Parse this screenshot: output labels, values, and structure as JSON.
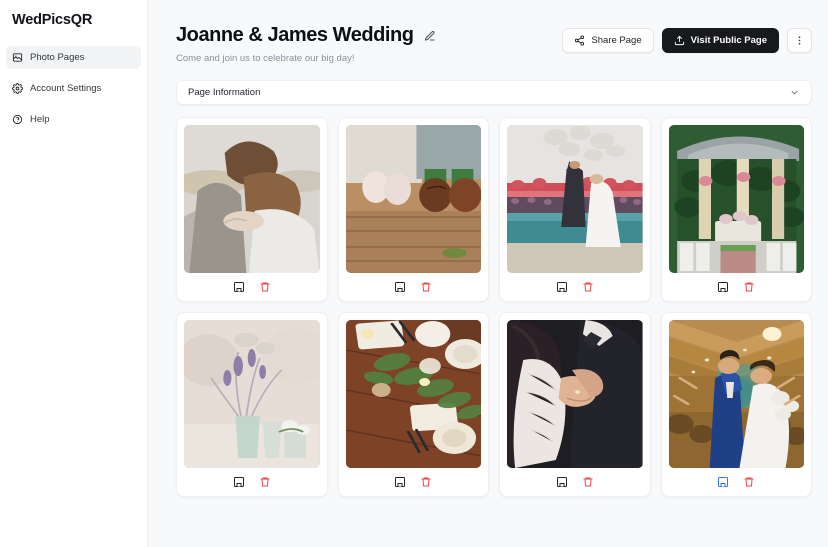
{
  "brand": "WedPicsQR",
  "sidebar": {
    "items": [
      {
        "label": "Photo Pages",
        "icon": "image-icon",
        "active": true
      },
      {
        "label": "Account Settings",
        "icon": "gear-icon",
        "active": false
      },
      {
        "label": "Help",
        "icon": "help-circle-icon",
        "active": false
      }
    ]
  },
  "header": {
    "title": "Joanne & James Wedding",
    "subtitle": "Come and join us to celebrate our big day!",
    "edit_icon": "pencil-icon",
    "share_label": "Share Page",
    "share_icon": "share-icon",
    "visit_label": "Visit Public Page",
    "visit_icon": "upload-icon",
    "more_icon": "more-vertical-icon"
  },
  "accordion": {
    "label": "Page Information",
    "chevron_icon": "chevron-down-icon",
    "expanded": false
  },
  "photo_actions": {
    "download_icon": "download-image-icon",
    "delete_icon": "trash-icon"
  },
  "colors": {
    "accent_dark": "#17191d",
    "danger": "#ef4444",
    "link_blue": "#3b74e8",
    "page_bg": "#f8f9fb",
    "surface": "#ffffff"
  },
  "photos": [
    {
      "alt": "Couple embracing outdoors",
      "download_state": "default"
    },
    {
      "alt": "Bride and groom shoes on wooden deck",
      "download_state": "default"
    },
    {
      "alt": "Ceremony with balloon release",
      "download_state": "default"
    },
    {
      "alt": "Garden gazebo ceremony setup",
      "download_state": "default"
    },
    {
      "alt": "Lavender flowers in glass vases",
      "download_state": "default"
    },
    {
      "alt": "Reception table setting with greenery",
      "download_state": "default"
    },
    {
      "alt": "First dance close-up of hands",
      "download_state": "default"
    },
    {
      "alt": "Recessional through cheering guests",
      "download_state": "active"
    }
  ]
}
